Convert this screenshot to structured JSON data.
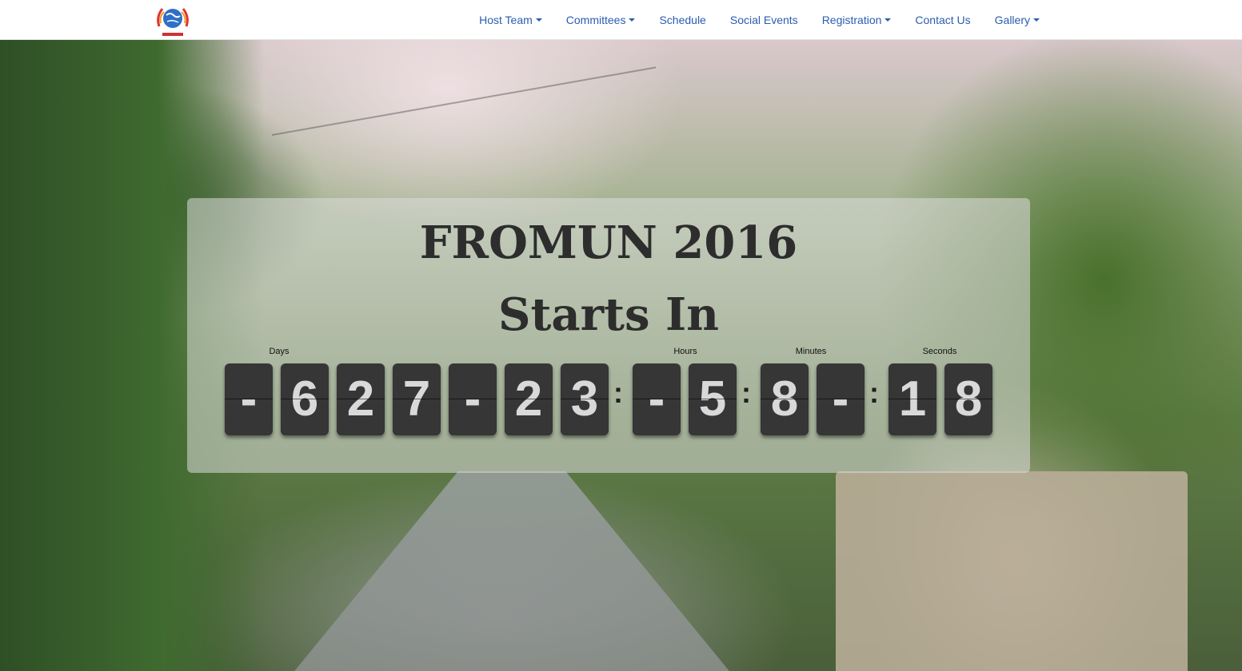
{
  "nav": {
    "items": [
      {
        "label": "Host Team",
        "dropdown": true
      },
      {
        "label": "Committees",
        "dropdown": true
      },
      {
        "label": "Schedule",
        "dropdown": false
      },
      {
        "label": "Social Events",
        "dropdown": false
      },
      {
        "label": "Registration",
        "dropdown": true
      },
      {
        "label": "Contact Us",
        "dropdown": false
      },
      {
        "label": "Gallery",
        "dropdown": true
      }
    ]
  },
  "hero": {
    "title": "FROMUN 2016",
    "subtitle": "Starts In"
  },
  "countdown": {
    "labels": {
      "days": "Days",
      "hours": "Hours",
      "minutes": "Minutes",
      "seconds": "Seconds"
    },
    "digits": [
      "-",
      "6",
      "2",
      "7",
      "-",
      "2",
      "3",
      "-",
      "5",
      "8",
      "-",
      "1",
      "8"
    ],
    "separators": [
      ":",
      ":",
      ":"
    ]
  },
  "colors": {
    "nav_link": "#2a5db0",
    "tile_bg": "#363636",
    "tile_text": "#d9d9d9",
    "title_text": "#2d2d2d"
  }
}
